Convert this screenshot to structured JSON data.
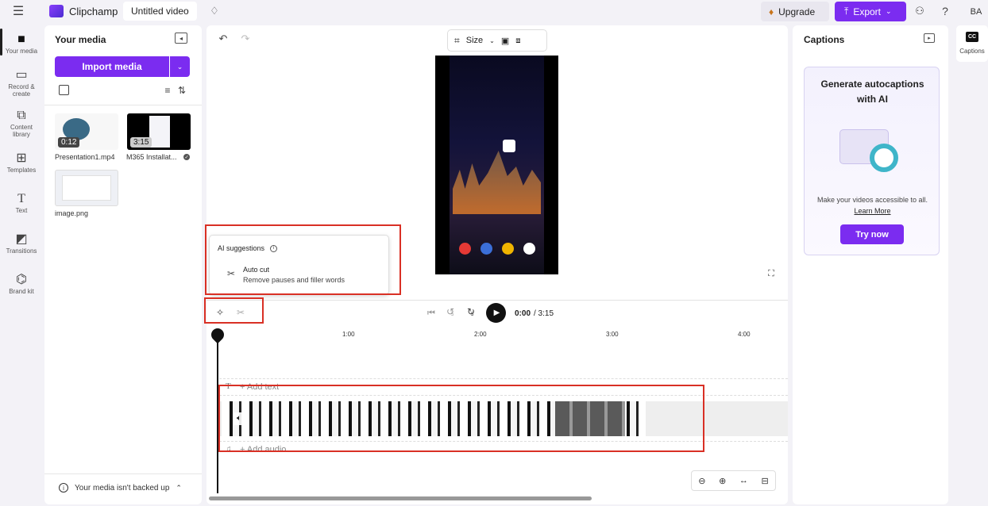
{
  "topbar": {
    "app_name": "Clipchamp",
    "project_title": "Untitled video",
    "upgrade_label": "Upgrade",
    "export_label": "Export",
    "avatar_initials": "BA",
    "help_glyph": "?"
  },
  "rail": {
    "items": [
      {
        "label": "Your media",
        "icon": "folder-icon"
      },
      {
        "label": "Record & create",
        "icon": "camera-icon"
      },
      {
        "label": "Content library",
        "icon": "library-icon"
      },
      {
        "label": "Templates",
        "icon": "templates-icon"
      },
      {
        "label": "Text",
        "icon": "text-icon"
      },
      {
        "label": "Transitions",
        "icon": "transitions-icon"
      },
      {
        "label": "Brand kit",
        "icon": "brand-kit-icon"
      }
    ]
  },
  "media": {
    "title": "Your media",
    "import_label": "Import media",
    "items": [
      {
        "name": "Presentation1.mp4",
        "duration": "0:12"
      },
      {
        "name": "M365 Installat...",
        "duration": "3:15"
      },
      {
        "name": "image.png",
        "duration": ""
      }
    ],
    "backup_notice": "Your media isn't backed up"
  },
  "preview": {
    "size_label": "Size",
    "ai_suggestions_title": "AI suggestions",
    "auto_cut_title": "Auto cut",
    "auto_cut_desc": "Remove pauses and filler words",
    "time_current": "0:00",
    "time_total": "/ 3:15",
    "skip_seconds": "5"
  },
  "timeline": {
    "ruler_labels": [
      "1:00",
      "2:00",
      "3:00",
      "4:00"
    ],
    "add_text_label": "+ Add text",
    "add_audio_label": "+ Add audio"
  },
  "captions": {
    "title": "Captions",
    "card_title": "Generate autocaptions with AI",
    "card_desc": "Make your videos accessible to all.",
    "learn_more": "Learn More",
    "try_now": "Try now",
    "rail_label": "Captions",
    "rail_badge": "CC"
  },
  "colors": {
    "accent": "#7b2cf0",
    "highlight": "#d93025"
  }
}
